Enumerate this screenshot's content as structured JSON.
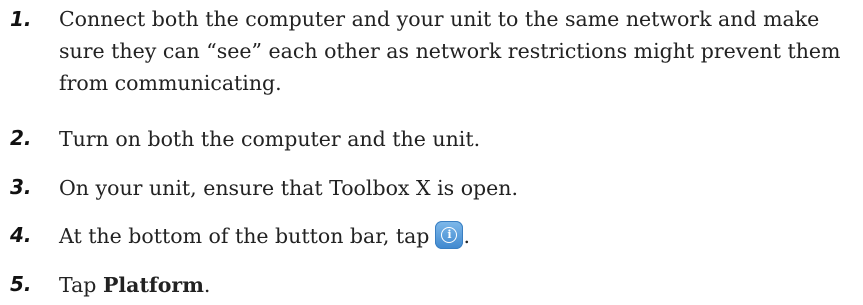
{
  "steps": [
    {
      "number": "1.",
      "text": "Connect both the computer and your unit to the same network and make sure they can “see” each other as network restrictions might prevent them from communicating."
    },
    {
      "number": "2.",
      "text": "Turn on both the computer and the unit."
    },
    {
      "number": "3.",
      "text": "On your unit, ensure that Toolbox X is open."
    },
    {
      "number": "4.",
      "text_before": "At the bottom of the button bar, tap",
      "icon": "info-icon",
      "text_after": "."
    },
    {
      "number": "5.",
      "text_before": "Tap ",
      "bold": "Platform",
      "text_after": "."
    }
  ]
}
